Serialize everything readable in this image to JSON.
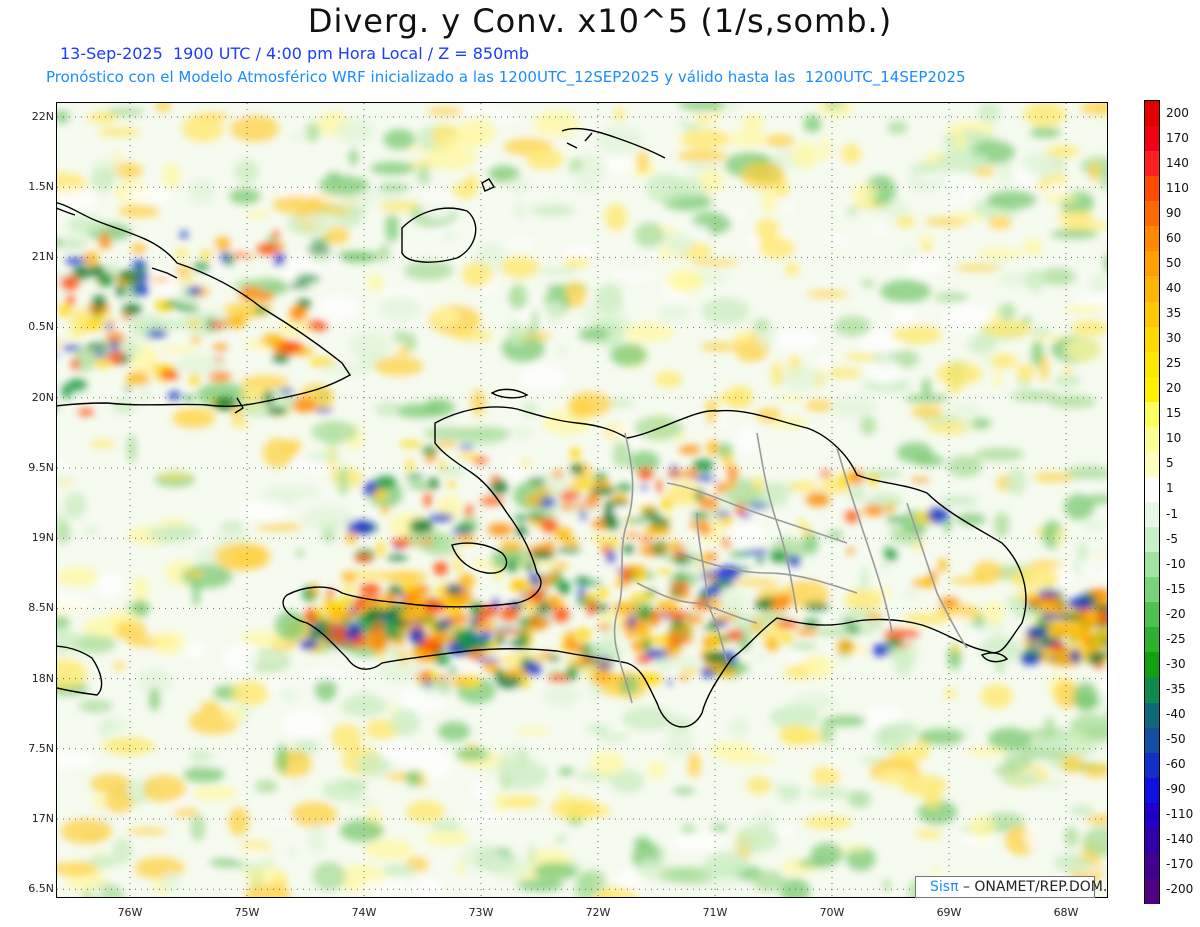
{
  "header": {
    "title": "Diverg. y Conv. x10^5 (1/s,somb.)",
    "line1": "13-Sep-2025  1900 UTC / 4:00 pm Hora Local / Z = 850mb",
    "line2": "Pronóstico con el Modelo Atmosférico WRF inicializado a las 1200UTC_12SEP2025 y válido hasta las  1200UTC_14SEP2025"
  },
  "map": {
    "lat_labels": [
      "22N",
      "1.5N",
      "21N",
      "0.5N",
      "20N",
      "9.5N",
      "19N",
      "8.5N",
      "18N",
      "7.5N",
      "17N",
      "6.5N"
    ],
    "lon_labels": [
      "76W",
      "75W",
      "74W",
      "73W",
      "72W",
      "71W",
      "70W",
      "69W",
      "68W"
    ],
    "lon_range": [
      -76.6,
      -67.6
    ],
    "lat_range": [
      16.45,
      22.1
    ]
  },
  "colorbar": {
    "labels": [
      "200",
      "170",
      "140",
      "110",
      "90",
      "60",
      "50",
      "40",
      "35",
      "30",
      "25",
      "20",
      "15",
      "10",
      "5",
      "1",
      "-1",
      "-5",
      "-10",
      "-15",
      "-20",
      "-25",
      "-30",
      "-35",
      "-40",
      "-50",
      "-60",
      "-90",
      "-110",
      "-140",
      "-170",
      "-200"
    ],
    "colors": [
      "#e00000",
      "#f00010",
      "#ff2020",
      "#ff4a00",
      "#ff6a00",
      "#ff8a00",
      "#ffa000",
      "#ffb400",
      "#ffc800",
      "#ffd800",
      "#ffe800",
      "#fff200",
      "#ffff60",
      "#ffff99",
      "#ffffc0",
      "#ffffff",
      "#e8f8e8",
      "#c8f0c8",
      "#a0e4a0",
      "#78d478",
      "#50c050",
      "#30b030",
      "#10a010",
      "#108850",
      "#106878",
      "#1050a0",
      "#1030c8",
      "#1010e0",
      "#2000c8",
      "#3000a8",
      "#400090",
      "#500080"
    ]
  },
  "credit": {
    "brand": "Sisπ",
    "text": "– ONAMET/REP.DOM."
  }
}
